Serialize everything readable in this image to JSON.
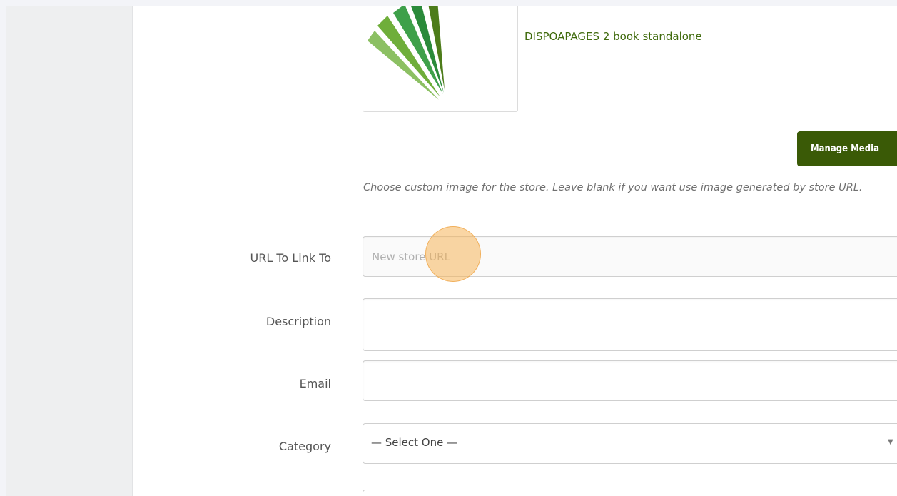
{
  "media": {
    "product_name": "DISPOAPAGES 2 book standalone",
    "manage_button_label": "Manage Media",
    "help_text": "Choose custom image for the store. Leave blank if you want use image generated by store URL.",
    "thumbnail_icon": "green-fan-logo-icon"
  },
  "form": {
    "url": {
      "label": "URL To Link To",
      "placeholder": "New store URL",
      "value": ""
    },
    "description": {
      "label": "Description",
      "value": ""
    },
    "email": {
      "label": "Email",
      "value": ""
    },
    "category": {
      "label": "Category",
      "selected": "— Select One —"
    }
  },
  "colors": {
    "accent_button": "#3a5a06",
    "product_link": "#3f6a0c",
    "click_highlight": "#f6b45a"
  }
}
